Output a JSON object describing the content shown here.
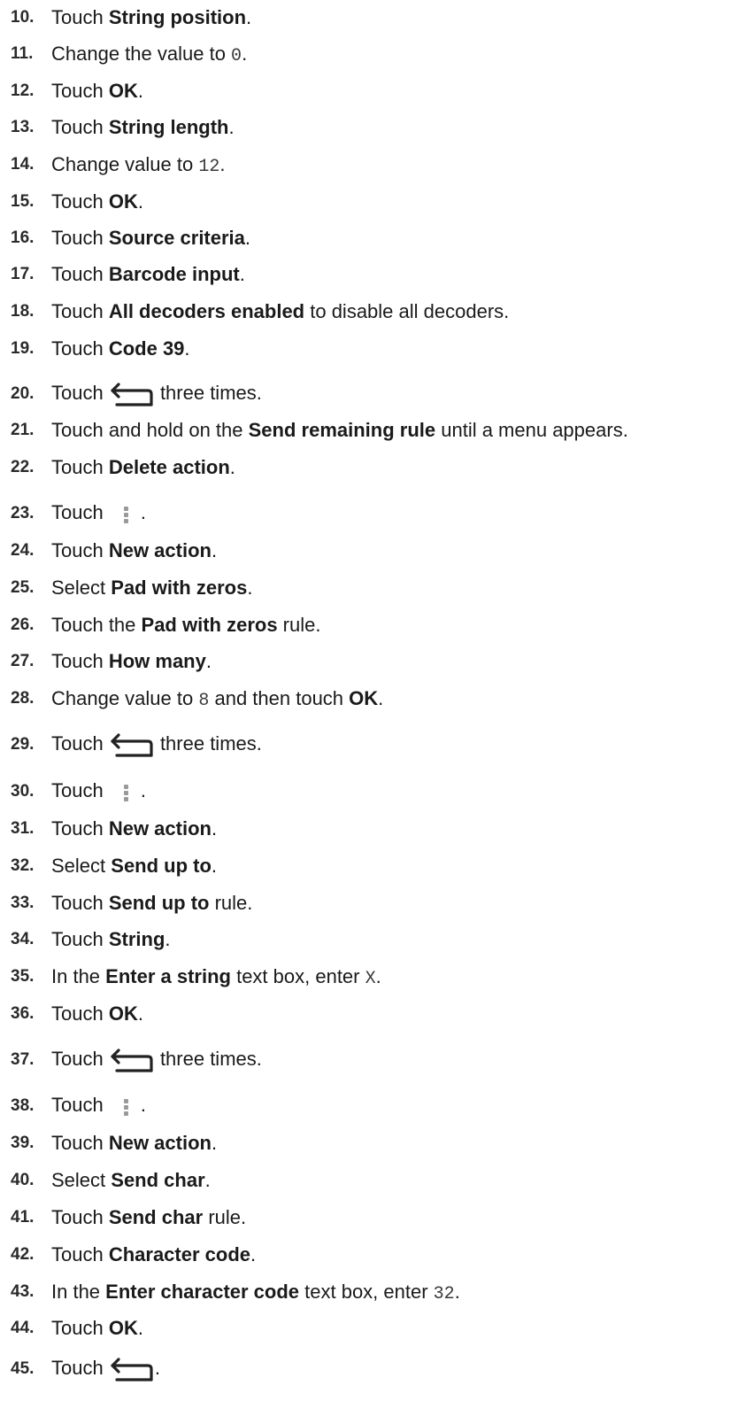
{
  "steps": [
    {
      "num": "10.",
      "parts": [
        {
          "t": "Touch "
        },
        {
          "t": "String position",
          "b": true
        },
        {
          "t": "."
        }
      ]
    },
    {
      "num": "11.",
      "parts": [
        {
          "t": "Change the value to "
        },
        {
          "t": "0",
          "code": true
        },
        {
          "t": "."
        }
      ]
    },
    {
      "num": "12.",
      "parts": [
        {
          "t": "Touch "
        },
        {
          "t": "OK",
          "b": true
        },
        {
          "t": "."
        }
      ]
    },
    {
      "num": "13.",
      "parts": [
        {
          "t": "Touch "
        },
        {
          "t": "String length",
          "b": true
        },
        {
          "t": "."
        }
      ]
    },
    {
      "num": "14.",
      "parts": [
        {
          "t": "Change value to "
        },
        {
          "t": "12",
          "code": true
        },
        {
          "t": "."
        }
      ]
    },
    {
      "num": "15.",
      "parts": [
        {
          "t": "Touch "
        },
        {
          "t": "OK",
          "b": true
        },
        {
          "t": "."
        }
      ]
    },
    {
      "num": "16.",
      "parts": [
        {
          "t": "Touch "
        },
        {
          "t": "Source criteria",
          "b": true
        },
        {
          "t": "."
        }
      ]
    },
    {
      "num": "17.",
      "parts": [
        {
          "t": "Touch "
        },
        {
          "t": "Barcode input",
          "b": true
        },
        {
          "t": "."
        }
      ]
    },
    {
      "num": "18.",
      "parts": [
        {
          "t": "Touch "
        },
        {
          "t": "All decoders enabled",
          "b": true
        },
        {
          "t": " to disable all decoders."
        }
      ]
    },
    {
      "num": "19.",
      "parts": [
        {
          "t": "Touch "
        },
        {
          "t": "Code 39",
          "b": true
        },
        {
          "t": "."
        }
      ]
    },
    {
      "num": "20.",
      "parts": [
        {
          "t": "Touch "
        },
        {
          "icon": "back-icon"
        },
        {
          "t": " three times."
        }
      ]
    },
    {
      "num": "21.",
      "parts": [
        {
          "t": "Touch and hold on the "
        },
        {
          "t": "Send remaining rule",
          "b": true
        },
        {
          "t": " until a menu appears."
        }
      ]
    },
    {
      "num": "22.",
      "parts": [
        {
          "t": "Touch "
        },
        {
          "t": "Delete action",
          "b": true
        },
        {
          "t": "."
        }
      ]
    },
    {
      "num": "23.",
      "parts": [
        {
          "t": "Touch "
        },
        {
          "icon": "menu-icon"
        },
        {
          "t": "."
        }
      ]
    },
    {
      "num": "24.",
      "parts": [
        {
          "t": "Touch "
        },
        {
          "t": "New action",
          "b": true
        },
        {
          "t": "."
        }
      ]
    },
    {
      "num": "25.",
      "parts": [
        {
          "t": "Select "
        },
        {
          "t": "Pad with zeros",
          "b": true
        },
        {
          "t": "."
        }
      ]
    },
    {
      "num": "26.",
      "parts": [
        {
          "t": "Touch the "
        },
        {
          "t": "Pad with zeros",
          "b": true
        },
        {
          "t": " rule."
        }
      ]
    },
    {
      "num": "27.",
      "parts": [
        {
          "t": "Touch "
        },
        {
          "t": "How many",
          "b": true
        },
        {
          "t": "."
        }
      ]
    },
    {
      "num": "28.",
      "parts": [
        {
          "t": "Change value to "
        },
        {
          "t": "8",
          "code": true
        },
        {
          "t": " and then touch "
        },
        {
          "t": "OK",
          "b": true
        },
        {
          "t": "."
        }
      ]
    },
    {
      "num": "29.",
      "parts": [
        {
          "t": "Touch "
        },
        {
          "icon": "back-icon"
        },
        {
          "t": " three times."
        }
      ]
    },
    {
      "num": "30.",
      "parts": [
        {
          "t": "Touch "
        },
        {
          "icon": "menu-icon"
        },
        {
          "t": "."
        }
      ]
    },
    {
      "num": "31.",
      "parts": [
        {
          "t": "Touch "
        },
        {
          "t": "New action",
          "b": true
        },
        {
          "t": "."
        }
      ]
    },
    {
      "num": "32.",
      "parts": [
        {
          "t": "Select "
        },
        {
          "t": "Send up to",
          "b": true
        },
        {
          "t": "."
        }
      ]
    },
    {
      "num": "33.",
      "parts": [
        {
          "t": "Touch "
        },
        {
          "t": "Send up to",
          "b": true
        },
        {
          "t": " rule."
        }
      ]
    },
    {
      "num": "34.",
      "parts": [
        {
          "t": "Touch "
        },
        {
          "t": "String",
          "b": true
        },
        {
          "t": "."
        }
      ]
    },
    {
      "num": "35.",
      "parts": [
        {
          "t": "In the "
        },
        {
          "t": "Enter a string",
          "b": true
        },
        {
          "t": " text box, enter "
        },
        {
          "t": "X",
          "code": true
        },
        {
          "t": "."
        }
      ]
    },
    {
      "num": "36.",
      "parts": [
        {
          "t": "Touch "
        },
        {
          "t": "OK",
          "b": true
        },
        {
          "t": "."
        }
      ]
    },
    {
      "num": "37.",
      "parts": [
        {
          "t": "Touch "
        },
        {
          "icon": "back-icon"
        },
        {
          "t": " three times."
        }
      ]
    },
    {
      "num": "38.",
      "parts": [
        {
          "t": "Touch "
        },
        {
          "icon": "menu-icon"
        },
        {
          "t": "."
        }
      ]
    },
    {
      "num": "39.",
      "parts": [
        {
          "t": "Touch "
        },
        {
          "t": "New action",
          "b": true
        },
        {
          "t": "."
        }
      ]
    },
    {
      "num": "40.",
      "parts": [
        {
          "t": "Select "
        },
        {
          "t": "Send char",
          "b": true
        },
        {
          "t": "."
        }
      ]
    },
    {
      "num": "41.",
      "parts": [
        {
          "t": "Touch "
        },
        {
          "t": "Send char",
          "b": true
        },
        {
          "t": " rule."
        }
      ]
    },
    {
      "num": "42.",
      "parts": [
        {
          "t": "Touch "
        },
        {
          "t": "Character code",
          "b": true
        },
        {
          "t": "."
        }
      ]
    },
    {
      "num": "43.",
      "parts": [
        {
          "t": "In the "
        },
        {
          "t": "Enter character code",
          "b": true
        },
        {
          "t": " text box, enter "
        },
        {
          "t": "32",
          "code": true
        },
        {
          "t": "."
        }
      ]
    },
    {
      "num": "44.",
      "parts": [
        {
          "t": "Touch "
        },
        {
          "t": "OK",
          "b": true
        },
        {
          "t": "."
        }
      ]
    },
    {
      "num": "45.",
      "parts": [
        {
          "t": "Touch "
        },
        {
          "icon": "back-icon"
        },
        {
          "t": "."
        }
      ]
    }
  ]
}
